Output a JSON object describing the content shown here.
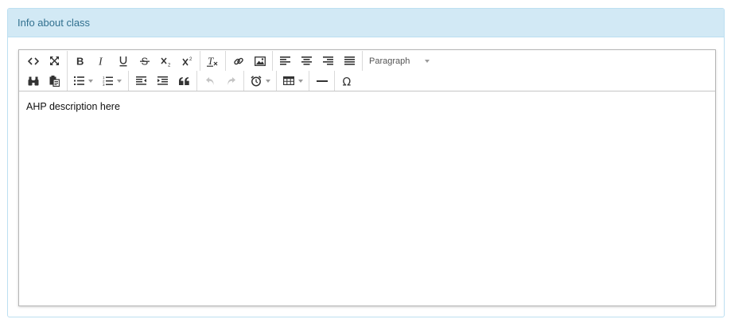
{
  "panel": {
    "title": "Info about class"
  },
  "toolbar": {
    "format_select": "Paragraph"
  },
  "editor": {
    "content": "AHP description here"
  },
  "icons": [
    "code-icon",
    "fullscreen-icon",
    "bold-icon",
    "italic-icon",
    "underline-icon",
    "strikethrough-icon",
    "subscript-icon",
    "superscript-icon",
    "clear-formatting-icon",
    "link-icon",
    "image-icon",
    "align-left-icon",
    "align-center-icon",
    "align-right-icon",
    "align-justify-icon",
    "find-replace-icon",
    "paste-text-icon",
    "bullet-list-icon",
    "numbered-list-icon",
    "outdent-icon",
    "indent-icon",
    "blockquote-icon",
    "undo-icon",
    "redo-icon",
    "insert-datetime-icon",
    "table-icon",
    "horizontal-rule-icon",
    "special-character-icon"
  ],
  "colors": {
    "heading_bg": "#d2e9f5",
    "heading_border": "#bcdff1",
    "heading_text": "#31708f",
    "editor_border": "#b6b6b6",
    "icon": "#333333",
    "icon_disabled": "#c4c4c4"
  }
}
